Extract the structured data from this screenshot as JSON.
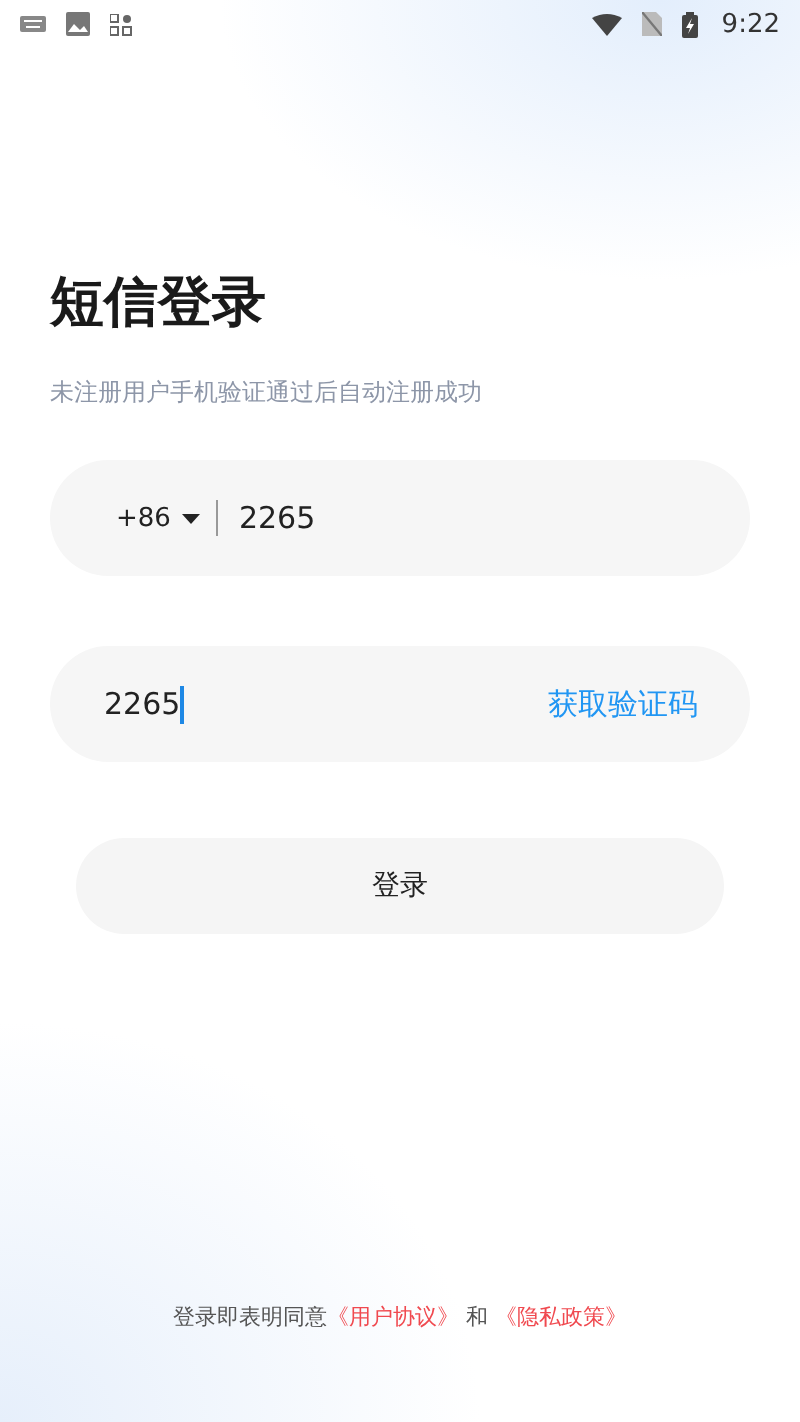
{
  "status_bar": {
    "time": "9:22"
  },
  "title": "短信登录",
  "subtitle": "未注册用户手机验证通过后自动注册成功",
  "phone_field": {
    "country_code": "+86",
    "value": "2265"
  },
  "code_field": {
    "value": "2265",
    "focused": true,
    "action": "获取验证码"
  },
  "login_button": {
    "label": "登录"
  },
  "agreement": {
    "text": "登录即表明同意",
    "link_1": "《用户协议》",
    "joiner": "和",
    "link_2": "《隐私政策》"
  }
}
